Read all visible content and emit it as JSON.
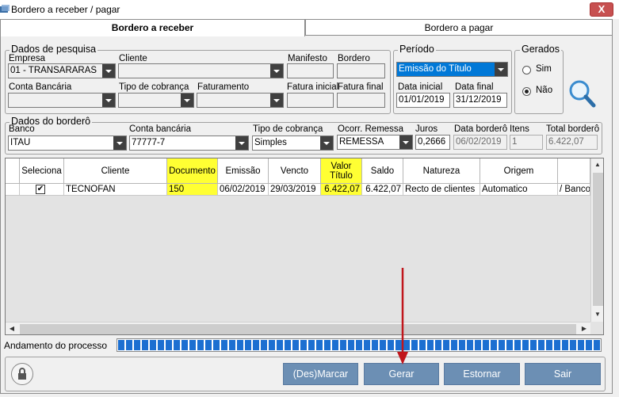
{
  "window": {
    "title": "Bordero a receber / pagar",
    "close_symbol": "X"
  },
  "tabs": [
    {
      "label": "Bordero a receber"
    },
    {
      "label": "Bordero a pagar"
    }
  ],
  "search": {
    "legend": "Dados de pesquisa",
    "empresa": {
      "label": "Empresa",
      "value": "01 - TRANSARARAS"
    },
    "cliente": {
      "label": "Cliente",
      "value": ""
    },
    "manifesto": {
      "label": "Manifesto",
      "value": ""
    },
    "bordero": {
      "label": "Bordero",
      "value": ""
    },
    "conta_bancaria": {
      "label": "Conta Bancária",
      "value": ""
    },
    "tipo_cobranca": {
      "label": "Tipo de cobrança",
      "value": ""
    },
    "faturamento": {
      "label": "Faturamento",
      "value": ""
    },
    "fatura_inicial": {
      "label": "Fatura inicial",
      "value": ""
    },
    "fatura_final": {
      "label": "Fatura final",
      "value": ""
    }
  },
  "periodo": {
    "legend": "Período",
    "tipo": "Emissão do Título",
    "data_inicial": {
      "label": "Data inicial",
      "value": "01/01/2019"
    },
    "data_final": {
      "label": "Data final",
      "value": "31/12/2019"
    }
  },
  "gerados": {
    "legend": "Gerados",
    "sim": "Sim",
    "nao": "Não",
    "selected": "nao"
  },
  "bordero_data": {
    "legend": "Dados do borderô",
    "banco": {
      "label": "Banco",
      "value": "ITAU"
    },
    "conta_bancaria": {
      "label": "Conta bancária",
      "value": "77777-7"
    },
    "tipo_cobranca": {
      "label": "Tipo de cobrança",
      "value": "Simples"
    },
    "ocorr_remessa": {
      "label": "Ocorr. Remessa",
      "value": "REMESSA"
    },
    "juros": {
      "label": "Juros",
      "value": "0,2666"
    },
    "data_bordero": {
      "label": "Data borderô",
      "value": "06/02/2019"
    },
    "itens": {
      "label": "Itens",
      "value": "1"
    },
    "total_bordero": {
      "label": "Total borderô",
      "value": "6.422,07"
    }
  },
  "grid": {
    "columns": [
      "Seleciona",
      "Cliente",
      "Documento",
      "Emissão",
      "Vencto",
      "Valor Título",
      "Saldo",
      "Natureza",
      "Origem",
      ""
    ],
    "valor_titulo_lines": [
      "Valor",
      "Título"
    ],
    "rows": [
      {
        "seleciona": "✔",
        "cliente": "TECNOFAN",
        "documento": "150",
        "emissao": "06/02/2019",
        "vencto": "29/03/2019",
        "valor_titulo": "6.422,07",
        "saldo": "6.422,07",
        "natureza": "Recto de clientes",
        "origem": "Automatico",
        "extra": "/ Banco"
      }
    ]
  },
  "progress": {
    "label": "Andamento do processo",
    "fraction": 1.0
  },
  "buttons": {
    "desmarcar": "(Des)Marcar",
    "gerar": "Gerar",
    "estornar": "Estornar",
    "sair": "Sair"
  },
  "colors": {
    "highlight": "#ffff33",
    "button": "#6c8fb4",
    "progress": "#1c6fd1",
    "arrow": "#c0161c"
  }
}
